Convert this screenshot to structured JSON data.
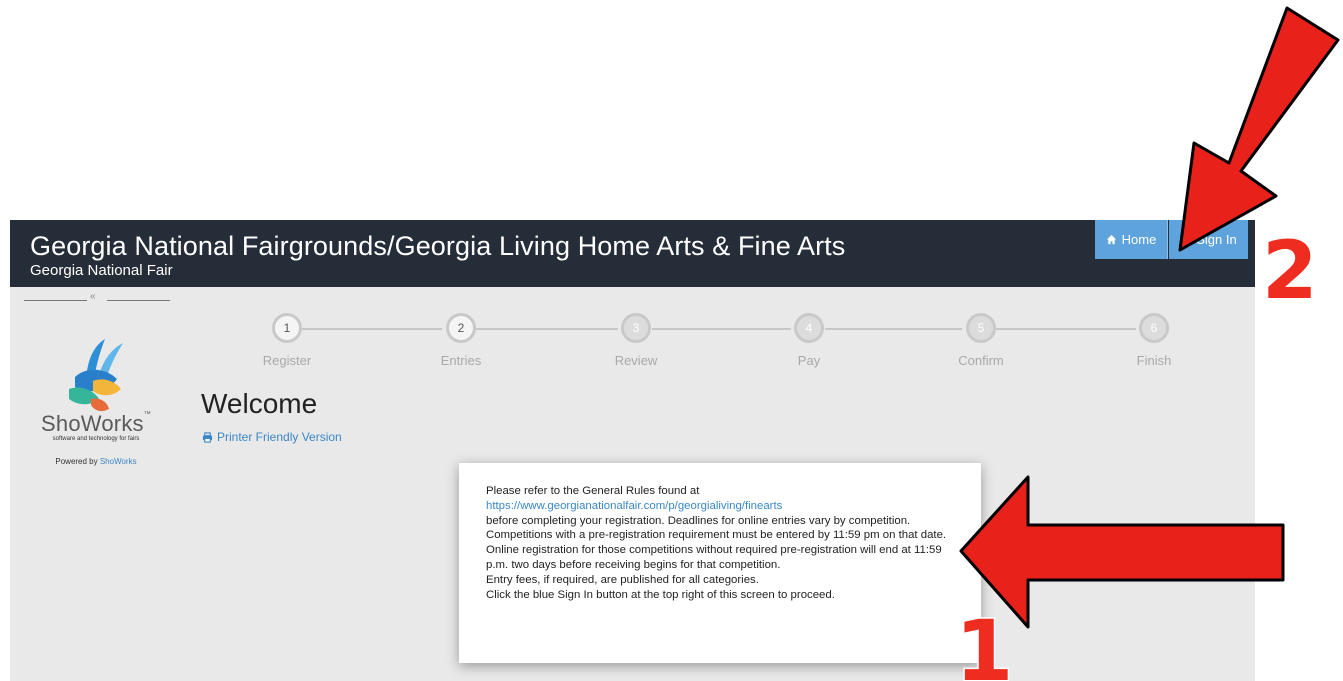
{
  "header": {
    "title": "Georgia National Fairgrounds/Georgia Living Home Arts & Fine Arts",
    "subtitle": "Georgia National Fair",
    "home_label": "Home",
    "signin_label": "Sign In"
  },
  "sidebar": {
    "collapse_glyph": "«",
    "brand_name": "ShoWorks",
    "brand_mark": "™",
    "tagline": "software and technology for fairs",
    "powered_prefix": "Powered by ",
    "powered_link": "ShoWorks"
  },
  "steps": [
    {
      "number": "1",
      "label": "Register"
    },
    {
      "number": "2",
      "label": "Entries"
    },
    {
      "number": "3",
      "label": "Review"
    },
    {
      "number": "4",
      "label": "Pay"
    },
    {
      "number": "5",
      "label": "Confirm"
    },
    {
      "number": "6",
      "label": "Finish"
    }
  ],
  "main": {
    "title": "Welcome",
    "printer_link": "Printer Friendly Version"
  },
  "notice": {
    "line_intro": "Please refer to the General Rules found at",
    "rules_url": "https://www.georgianationalfair.com/p/georgialiving/finearts",
    "paragraph": "before completing your registration.  Deadlines for online entries vary by competition. Competitions with a pre-registration requirement must be entered by 11:59 pm on that date. Online registration for those competitions without required pre-registration will end at 11:59 p.m. two days before receiving begins for that competition.",
    "fees": "Entry fees, if required, are published for all categories.",
    "proceed": "Click the blue Sign In button at the top right of this screen to proceed."
  },
  "annotations": {
    "marker_1": "1",
    "marker_2": "2",
    "arrow_color": "#e8221b"
  },
  "colors": {
    "header_bg": "#252e38",
    "button_blue": "#5ea3dc",
    "link_blue": "#3a87c8"
  }
}
